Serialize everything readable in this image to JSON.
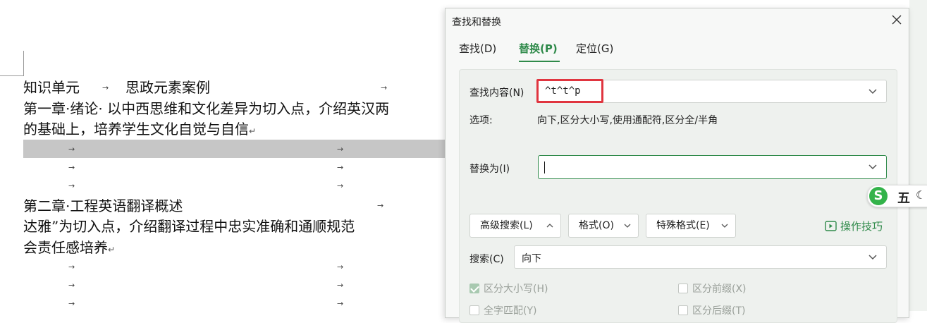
{
  "document": {
    "line1_a": "知识单元",
    "line1_b": "思政元素案例",
    "line2": "第一章·绪论· 以中西思维和文化差异为切入点，介绍英汉两",
    "line3": "的基础上，培养学生文化自觉与自信",
    "line4": "第二章·工程英语翻译概述",
    "line5": "达雅”为切入点，介绍翻译过程中忠实准确和通顺规范",
    "line6": "会责任感培养",
    "tab_glyph": "→",
    "para_glyph": "↵"
  },
  "dialog": {
    "title": "查找和替换",
    "tabs": [
      {
        "label": "查找(D)"
      },
      {
        "label": "替换(P)"
      },
      {
        "label": "定位(G)"
      }
    ],
    "find_label": "查找内容(N)",
    "find_value": "^t^t^p",
    "options_label": "选项:",
    "options_value": "向下,区分大小写,使用通配符,区分全/半角",
    "replace_label": "替换为(I)",
    "replace_value": "",
    "advanced_button": "高级搜索(L)",
    "format_button": "格式(O)",
    "special_button": "特殊格式(E)",
    "tips_label": "操作技巧",
    "search_label": "搜索(C)",
    "search_value": "向下",
    "checkbox_case": "区分大小写(H)",
    "checkbox_prefix": "区分前缀(X)",
    "checkbox_whole": "全字匹配(Y)",
    "checkbox_suffix": "区分后缀(T)"
  },
  "ime": {
    "logo": "S",
    "mode": "五",
    "moon": "☾"
  },
  "colors": {
    "accent": "#2f8a4a",
    "highlight": "#e0353f"
  }
}
